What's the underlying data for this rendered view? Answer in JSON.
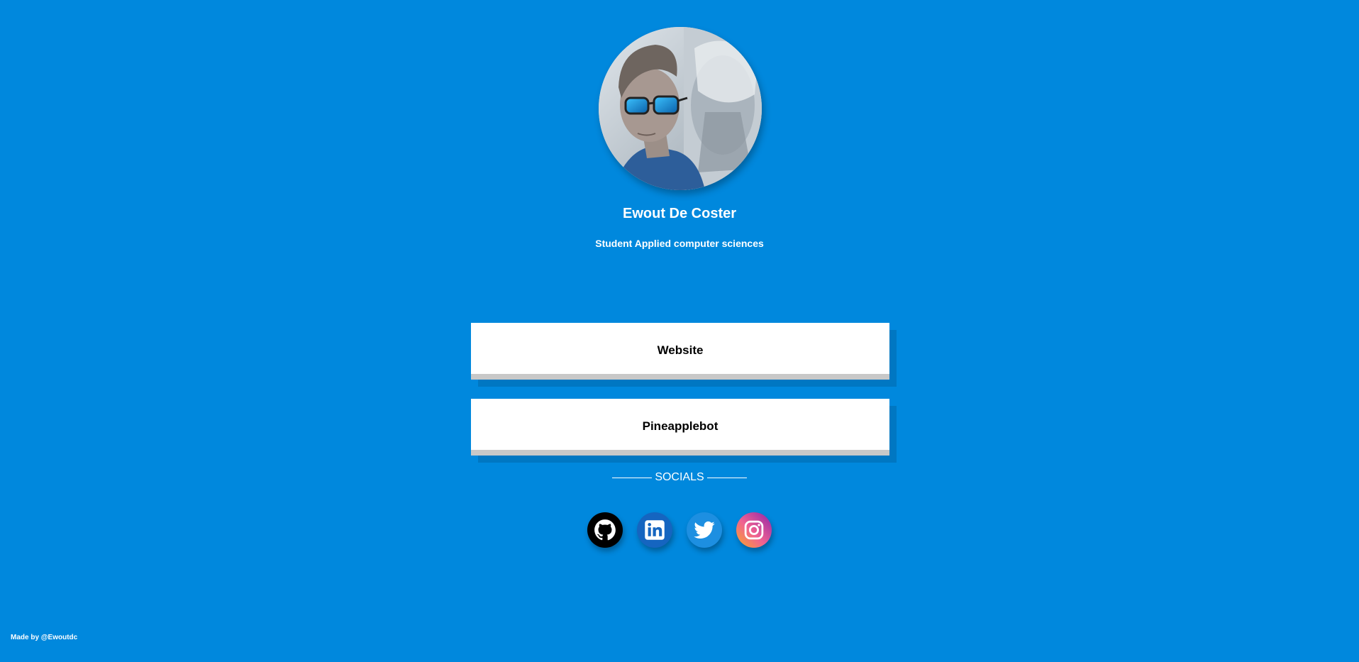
{
  "profile": {
    "name": "Ewout De Coster",
    "tagline": "Student Applied computer sciences",
    "avatar_icon": "profile-photo"
  },
  "links": [
    {
      "label": "Website"
    },
    {
      "label": "Pineapplebot"
    }
  ],
  "socials": {
    "heading": "SOCIALS",
    "items": [
      {
        "name": "GitHub",
        "icon": "github-icon",
        "color": "#000000"
      },
      {
        "name": "LinkedIn",
        "icon": "linkedin-icon",
        "color": "#0a66c2"
      },
      {
        "name": "Twitter",
        "icon": "twitter-icon",
        "color": "#1d9bf0"
      },
      {
        "name": "Instagram",
        "icon": "instagram-icon",
        "color": "#e1306c"
      }
    ]
  },
  "footer": {
    "text": "Made by @Ewoutdc"
  },
  "colors": {
    "background": "#0088dd",
    "card": "#ffffff",
    "card_border": "#c8c8c8",
    "text_light": "#ffffff"
  }
}
